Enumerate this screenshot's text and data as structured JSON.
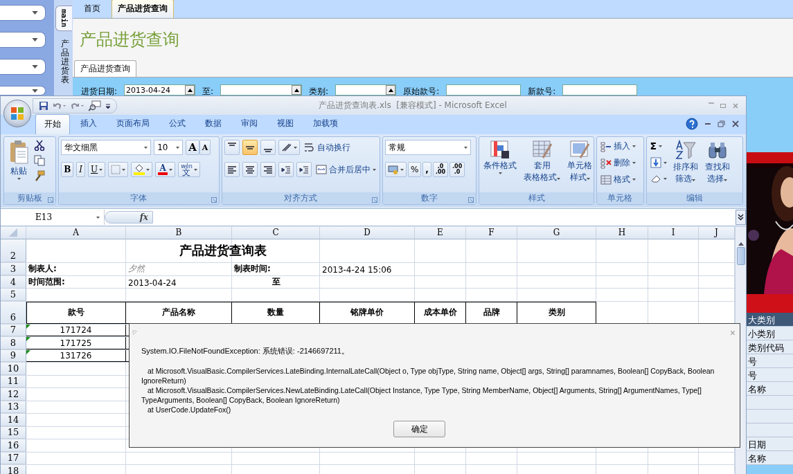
{
  "sidebar": {
    "dropdowns": [
      {
        "kind": "dropdown"
      },
      {
        "kind": "dropdown"
      },
      {
        "kind": "dropdown"
      },
      {
        "kind": "dropdown"
      }
    ]
  },
  "side_tabs": [
    {
      "label": "main",
      "selected": true
    },
    {
      "label": "产品进货表",
      "selected": false
    }
  ],
  "top_tabs": [
    {
      "label": "首页",
      "selected": false
    },
    {
      "label": "产品进货查询",
      "selected": true
    }
  ],
  "page_title": "产品进货查询",
  "inner_tabs": [
    {
      "label": "产品进货查询",
      "selected": true
    }
  ],
  "filter": {
    "fields": [
      {
        "label": "进货日期:",
        "value": "2013-04-24",
        "kind": "spinner"
      },
      {
        "label": "至:",
        "kind": "spinner"
      },
      {
        "label": "类别:",
        "kind": "spinner"
      },
      {
        "label": "原始款号:",
        "kind": "text"
      },
      {
        "label": "新款号:",
        "kind": "text"
      }
    ]
  },
  "right_list": [
    {
      "label": "大类别",
      "selected": true
    },
    {
      "label": "小类别",
      "selected": false
    },
    {
      "label": "类别代码",
      "selected": false
    },
    {
      "label": "号",
      "selected": false
    },
    {
      "label": "号",
      "selected": false
    },
    {
      "label": "名称",
      "selected": false
    },
    {
      "selected": false
    },
    {
      "selected": false
    },
    {
      "selected": false
    },
    {
      "label": "日期",
      "selected": false
    },
    {
      "label": "名称",
      "selected": false
    }
  ],
  "excel": {
    "title": "产品进货查询表.xls  [兼容模式] - Microsoft Excel",
    "ribbon_tabs": [
      {
        "label": "开始",
        "selected": true
      },
      {
        "label": "插入",
        "selected": false
      },
      {
        "label": "页面布局",
        "selected": false
      },
      {
        "label": "公式",
        "selected": false
      },
      {
        "label": "数据",
        "selected": false
      },
      {
        "label": "审阅",
        "selected": false
      },
      {
        "label": "视图",
        "selected": false
      },
      {
        "label": "加载项",
        "selected": false
      }
    ],
    "groups": [
      {
        "kind": "clipboard",
        "label": "剪贴板",
        "paste": "粘贴"
      },
      {
        "kind": "font",
        "label": "字体",
        "font": "华文细黑",
        "size": "10",
        "grow": "A",
        "shrink": "A",
        "styles": [
          "B",
          "I",
          "U"
        ],
        "color_letter": "A",
        "phonetic_top": "wén",
        "phonetic": "文"
      },
      {
        "kind": "alignment",
        "label": "对齐方式",
        "valign": [
          {
            "selected": false
          },
          {
            "selected": true
          },
          {
            "selected": false
          }
        ],
        "wrap": "自动换行",
        "merge": "合并后居中"
      },
      {
        "kind": "number",
        "label": "数字",
        "format": "常规",
        "percent": "%",
        "comma": ",",
        "increase_decimal": [
          ".0",
          ".00"
        ],
        "decrease_decimal": [
          ".00",
          ".0"
        ]
      },
      {
        "kind": "styles",
        "label": "样式",
        "buttons": [
          {
            "lines": [
              "条件格式"
            ]
          },
          {
            "lines": [
              "套用",
              "表格格式"
            ]
          },
          {
            "lines": [
              "单元格",
              "样式"
            ]
          }
        ]
      },
      {
        "kind": "cells",
        "label": "单元格",
        "buttons": [
          "插入",
          "删除",
          "格式"
        ]
      },
      {
        "kind": "editing",
        "label": "编辑",
        "sum": "Σ",
        "buttons": [
          {
            "lines": [
              "排序和",
              "筛选"
            ]
          },
          {
            "lines": [
              "查找和",
              "选择"
            ]
          }
        ]
      }
    ],
    "name_box": "E13",
    "fx": "fx",
    "columns": [
      "A",
      "B",
      "C",
      "D",
      "E",
      "F",
      "G",
      "H",
      "I",
      "J"
    ],
    "rows": [
      {
        "number": "2",
        "kind": "title",
        "cells": [
          {
            "text": ""
          },
          {
            "text": "产品进货查询表",
            "kind": "title"
          }
        ]
      },
      {
        "number": "3",
        "kind": "plain",
        "cells": [
          {
            "text": "制表人:",
            "kind": "label"
          },
          {
            "text": "夕然",
            "kind": "muted"
          },
          {
            "text": "制表时间:",
            "kind": "label"
          },
          {
            "text": "2013-4-24 15:06",
            "kind": "value"
          }
        ]
      },
      {
        "number": "4",
        "kind": "plain",
        "cells": [
          {
            "text": "时间范围:",
            "kind": "label"
          },
          {
            "text": "2013-04-24",
            "kind": "value"
          },
          {
            "text": "至",
            "kind": "center"
          }
        ]
      },
      {
        "number": "5",
        "kind": "plain",
        "cells": []
      },
      {
        "number": "6",
        "kind": "header",
        "cells": [
          {
            "text": "款号"
          },
          {
            "text": "产品名称"
          },
          {
            "text": "数量"
          },
          {
            "text": "铭牌单价"
          },
          {
            "text": "成本单价"
          },
          {
            "text": "品牌"
          },
          {
            "text": "类别"
          }
        ]
      },
      {
        "number": "7",
        "kind": "data",
        "cells": [
          {
            "text": "171724",
            "flag": true
          }
        ]
      },
      {
        "number": "8",
        "kind": "data",
        "cells": [
          {
            "text": "171725",
            "flag": true
          }
        ]
      },
      {
        "number": "9",
        "kind": "data",
        "cells": [
          {
            "text": "131726",
            "flag": true
          }
        ]
      },
      {
        "number": "10",
        "kind": "plain",
        "cells": []
      },
      {
        "number": "11",
        "kind": "plain",
        "cells": []
      },
      {
        "number": "12",
        "kind": "plain",
        "cells": []
      },
      {
        "number": "13",
        "kind": "plain",
        "cells": []
      },
      {
        "number": "14",
        "kind": "plain",
        "cells": []
      },
      {
        "number": "15",
        "kind": "plain",
        "cells": []
      },
      {
        "number": "16",
        "kind": "plain",
        "cells": []
      },
      {
        "number": "17",
        "kind": "plain",
        "cells": []
      },
      {
        "number": "18",
        "kind": "plain",
        "cells": []
      }
    ],
    "dialog": {
      "close": "×",
      "message": "System.IO.FileNotFoundException: 系统错误: -2146697211。",
      "stack": [
        "at Microsoft.VisualBasic.CompilerServices.LateBinding.InternalLateCall(Object o, Type objType, String name, Object[] args, String[] paramnames, Boolean[] CopyBack, Boolean IgnoreReturn)",
        "at Microsoft.VisualBasic.CompilerServices.NewLateBinding.LateCall(Object Instance, Type Type, String MemberName, Object[] Arguments, String[] ArgumentNames, Type[] TypeArguments, Boolean[] CopyBack, Boolean IgnoreReturn)",
        "at UserCode.UpdateFox()"
      ],
      "button": "确定"
    }
  }
}
